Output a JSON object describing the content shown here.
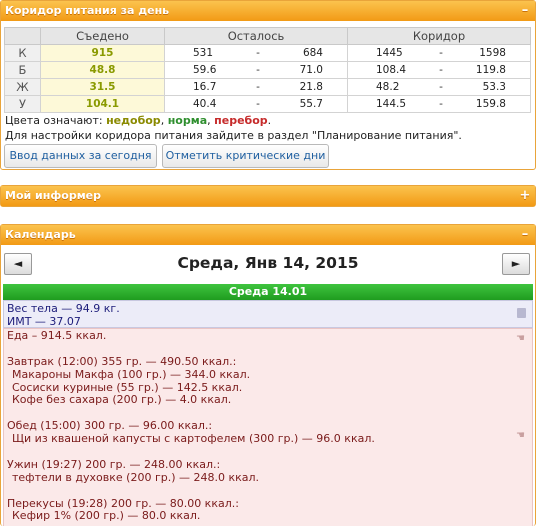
{
  "nutrition_panel": {
    "title": "Коридор питания за день",
    "toggle": "–",
    "headers": [
      "",
      "Съедено",
      "Осталось",
      "Коридор"
    ],
    "rows": [
      {
        "label": "К",
        "eaten": "915",
        "rest_min": "531",
        "rest_max": "684",
        "corr_min": "1445",
        "corr_max": "1598"
      },
      {
        "label": "Б",
        "eaten": "48.8",
        "rest_min": "59.6",
        "rest_max": "71.0",
        "corr_min": "108.4",
        "corr_max": "119.8"
      },
      {
        "label": "Ж",
        "eaten": "31.5",
        "rest_min": "16.7",
        "rest_max": "21.8",
        "corr_min": "48.2",
        "corr_max": "53.3"
      },
      {
        "label": "У",
        "eaten": "104.1",
        "rest_min": "40.4",
        "rest_max": "55.7",
        "corr_min": "144.5",
        "corr_max": "159.8"
      }
    ],
    "dash": "-",
    "legend_prefix": "Цвета означают:",
    "legend_low": "недобор",
    "legend_ok": "норма",
    "legend_over": "перебор",
    "comma": ",",
    "dot": ".",
    "hint": "Для настройки коридора питания зайдите в раздел \"Планирование питания\".",
    "btn_today": "Ввод данных за сегодня",
    "btn_critical": "Отметить критические дни",
    "colors": {
      "low": "#8a8a00",
      "ok": "#2f8f2f",
      "over": "#c62b2b"
    }
  },
  "informer_panel": {
    "title": "Мой информер",
    "toggle": "+"
  },
  "calendar_panel": {
    "title": "Календарь",
    "toggle": "–",
    "prev": "◄",
    "next": "►",
    "date_title": "Среда, Янв 14, 2015",
    "day_bar": "Среда 14.01",
    "weight": "Вес тела — 94.9 кг.",
    "bmi": "ИМТ — 37.07",
    "food_lines": [
      {
        "text": "Еда – 914.5 ккал.",
        "item": false
      },
      {
        "text": "",
        "item": false
      },
      {
        "text": "Завтрак (12:00) 355 гр. — 490.50 ккал.:",
        "item": false
      },
      {
        "text": "Макароны Макфа (100 гр.) — 344.0 ккал.",
        "item": true
      },
      {
        "text": "Сосиски куриные (55 гр.) — 142.5 ккал.",
        "item": true
      },
      {
        "text": "Кофе без сахара (200 гр.) — 4.0 ккал.",
        "item": true
      },
      {
        "text": "",
        "item": false
      },
      {
        "text": "Обед (15:00) 300 гр. — 96.00 ккал.:",
        "item": false
      },
      {
        "text": "Щи из квашеной капусты с картофелем (300 гр.) — 96.0 ккал.",
        "item": true
      },
      {
        "text": "",
        "item": false
      },
      {
        "text": "Ужин (19:27) 200 гр. — 248.00 ккал.:",
        "item": false
      },
      {
        "text": "тефтели в духовке (200 гр.) — 248.0 ккал.",
        "item": true
      },
      {
        "text": "",
        "item": false
      },
      {
        "text": "Перекусы (19:28) 200 гр. — 80.00 ккал.:",
        "item": false
      },
      {
        "text": "Кефир 1% (200 гр.) — 80.0 ккал.",
        "item": true
      }
    ]
  }
}
